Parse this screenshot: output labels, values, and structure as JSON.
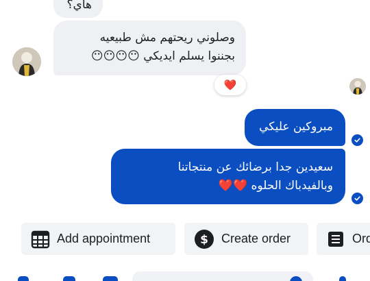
{
  "thread": {
    "messages": [
      {
        "direction": "incoming",
        "lines": [
          "هاي؟"
        ]
      },
      {
        "direction": "incoming",
        "lines": [
          "وصلوني ريحتهم مش طبيعيه",
          "بجننوا يسلم ايديكي 😶😶😶😶"
        ],
        "reaction": "❤️"
      },
      {
        "direction": "outgoing",
        "lines": [
          "مبروكين عليكي"
        ],
        "status": "seen"
      },
      {
        "direction": "outgoing",
        "lines": [
          "سعيدين جدا برضائك عن منتجاتنا",
          "وبالفيدباك الحلوه ❤️❤️"
        ],
        "status": "seen"
      }
    ]
  },
  "quick_actions": [
    {
      "label": "Add appointment",
      "icon": "calendar-grid-icon"
    },
    {
      "label": "Create order",
      "icon": "dollar-circle-icon"
    },
    {
      "label": "Ord",
      "icon": "order-list-icon"
    }
  ],
  "colors": {
    "accent": "#0a4ec2",
    "incoming_bubble": "#eef0f3",
    "chip_bg": "#f2f3f5",
    "reaction_heart": "#e41e3f"
  }
}
